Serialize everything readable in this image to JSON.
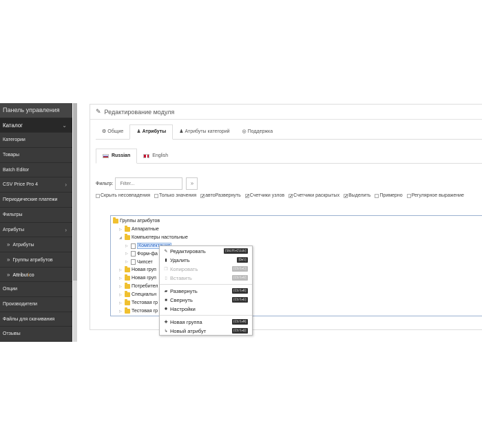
{
  "sidebar": {
    "items": [
      {
        "label": "Панель управления"
      },
      {
        "label": "Каталог",
        "chevron": "⌄"
      },
      {
        "label": "Категории"
      },
      {
        "label": "Товары"
      },
      {
        "label": "Batch Editor"
      },
      {
        "label": "CSV Price Pro 4",
        "chevron": "›"
      },
      {
        "label": "Периодические платежи"
      },
      {
        "label": "Фильтры"
      },
      {
        "label": "Атрибуты",
        "chevron": "›"
      },
      {
        "label": "Атрибуты"
      },
      {
        "label": "Группы атрибутов"
      },
      {
        "label_a": "Attribut",
        "label_b": "i",
        "label_c": "co"
      },
      {
        "label": "Опции"
      },
      {
        "label": "Производители"
      },
      {
        "label": "Файлы для скачивания"
      },
      {
        "label": "Отзывы"
      }
    ]
  },
  "panel": {
    "title": "Редактирование модуля",
    "tabs": [
      "Общие",
      "Атрибуты",
      "Атрибуты категорий",
      "Поддержка"
    ],
    "lang_tabs": [
      "Russian",
      "English"
    ],
    "filter_label": "Фильтр:",
    "filter_placeholder": "Filter...",
    "filter_clear": "»",
    "checkboxes": [
      {
        "label": "Скрыть несовпадения",
        "checked": false
      },
      {
        "label": "Только значения",
        "checked": false
      },
      {
        "label": "автоРазвернуть",
        "checked": true
      },
      {
        "label": "Счетчики узлов",
        "checked": true
      },
      {
        "label": "Счетчики раскрытых",
        "checked": true
      },
      {
        "label": "Выделить",
        "checked": true
      },
      {
        "label": "Примерно",
        "checked": false
      },
      {
        "label": "Регулярное выражение",
        "checked": false
      }
    ]
  },
  "tree": {
    "root": "Группы атрибутов",
    "n1": "Аппаратные",
    "n2": "Компьютеры настольные",
    "n3": "Комплектация",
    "n4": "Форм-фа",
    "n5": "Чипсет",
    "n6": "Новая груп",
    "n7": "Новая груп",
    "n8": "Потребител",
    "n9": "Специальн",
    "n10": "Тестовая гр",
    "n11": "Тестовая гр"
  },
  "context_menu": {
    "edit": {
      "label": "Редактировать",
      "shortcut": "[Shift+Click]"
    },
    "delete": {
      "label": "Удалить",
      "shortcut": "[Del]"
    },
    "copy": {
      "label": "Копировать",
      "shortcut": "[Ctrl+C]"
    },
    "paste": {
      "label": "Вставить",
      "shortcut": "[Ctrl+V]"
    },
    "expand": {
      "label": "Развернуть",
      "shortcut": "[Ctrl+R]"
    },
    "collapse": {
      "label": "Свернуть",
      "shortcut": "[Ctrl+E]"
    },
    "settings": {
      "label": "Настройки"
    },
    "new_group": {
      "label": "Новая группа",
      "shortcut": "[Ctrl+M]"
    },
    "new_attr": {
      "label": "Новый атрибут",
      "shortcut": "[Ctrl+Q]"
    }
  }
}
